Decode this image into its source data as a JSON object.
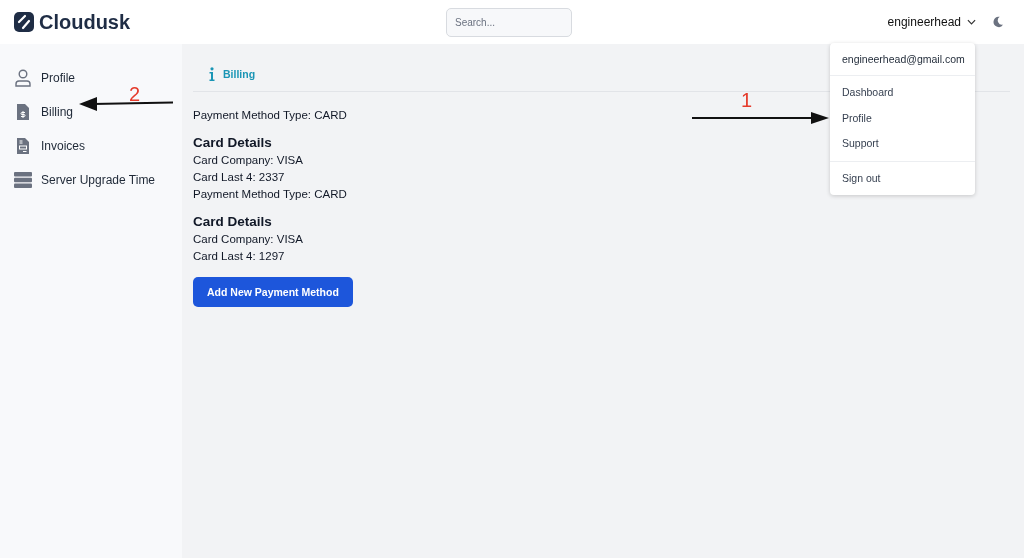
{
  "header": {
    "logo": "Cloudusk",
    "search": {
      "placeholder": "Search..."
    },
    "user": "engineerhead"
  },
  "sidebar": {
    "items": [
      {
        "label": "Profile",
        "kind": "person"
      },
      {
        "label": "Billing",
        "kind": "billing"
      },
      {
        "label": "Invoices",
        "kind": "invoice"
      },
      {
        "label": "Server Upgrade Time",
        "kind": "server"
      }
    ]
  },
  "main": {
    "tab": "Billing",
    "blocks": [
      {
        "kind": "line",
        "text": "Payment Method Type: CARD"
      },
      {
        "kind": "heading",
        "text": "Card Details"
      },
      {
        "kind": "line",
        "text": "Card Company: VISA"
      },
      {
        "kind": "line",
        "text": "Card Last 4: 2337"
      },
      {
        "kind": "line",
        "text": "Payment Method Type: CARD"
      },
      {
        "kind": "heading",
        "text": "Card Details"
      },
      {
        "kind": "line",
        "text": "Card Company: VISA"
      },
      {
        "kind": "line",
        "text": "Card Last 4: 1297"
      }
    ],
    "button": "Add New Payment Method"
  },
  "user_menu": {
    "email": "engineerhead@gmail.com",
    "groups": [
      [
        "Dashboard",
        "Profile",
        "Support"
      ],
      [
        "Sign out"
      ]
    ]
  },
  "annotations": [
    {
      "label": "1",
      "kind": "arrow-right"
    },
    {
      "label": "2",
      "kind": "arrow-left"
    }
  ]
}
